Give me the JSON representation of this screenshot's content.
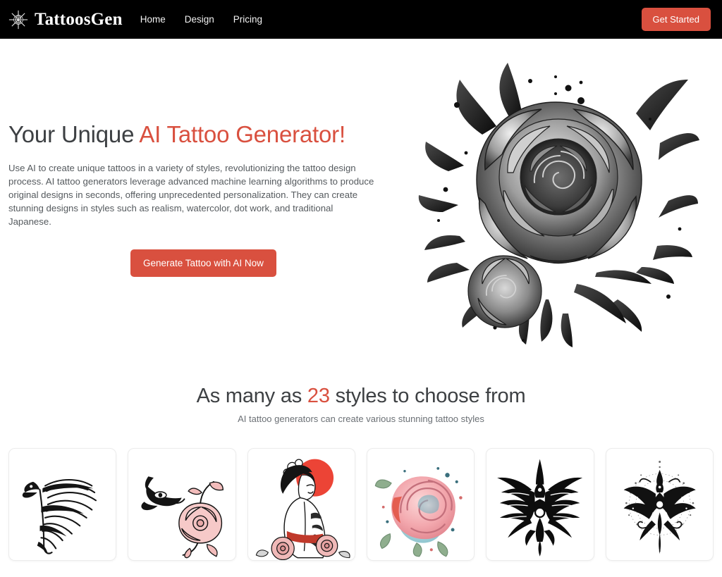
{
  "header": {
    "logo_icon": "mandala-starburst-icon",
    "brand_name": "TattoosGen",
    "nav": [
      {
        "label": "Home"
      },
      {
        "label": "Design"
      },
      {
        "label": "Pricing"
      }
    ],
    "cta_label": "Get Started"
  },
  "hero": {
    "title_plain": "Your Unique ",
    "title_accent": "AI Tattoo Generator!",
    "description": "Use AI to create unique tattoos in a variety of styles, revolutionizing the tattoo design process. AI tattoo generators leverage advanced machine learning algorithms to produce original designs in seconds, offering unprecedented personalization. They can create stunning designs in styles such as realism, watercolor, dot work, and traditional Japanese.",
    "cta_label": "Generate Tattoo with AI Now",
    "art_name": "black-grey-realism-rose-tattoo"
  },
  "styles": {
    "title_before": "As many as ",
    "title_count": "23",
    "title_after": " styles to choose from",
    "subtitle": "AI tattoo generators can create various stunning tattoo styles",
    "cards": [
      {
        "name": "phoenix-wing-tattoo"
      },
      {
        "name": "eagle-with-pink-rose-tattoo"
      },
      {
        "name": "geisha-with-red-sun-tattoo"
      },
      {
        "name": "watercolor-rose-tattoo"
      },
      {
        "name": "tribal-winged-ornament-tattoo"
      },
      {
        "name": "ornamental-mandala-butterfly-tattoo"
      }
    ]
  },
  "colors": {
    "accent": "#d9503f",
    "header_bg": "#000000",
    "page_bg": "#ffffff",
    "heading_text": "#3d4043",
    "body_text": "#555a5e"
  }
}
